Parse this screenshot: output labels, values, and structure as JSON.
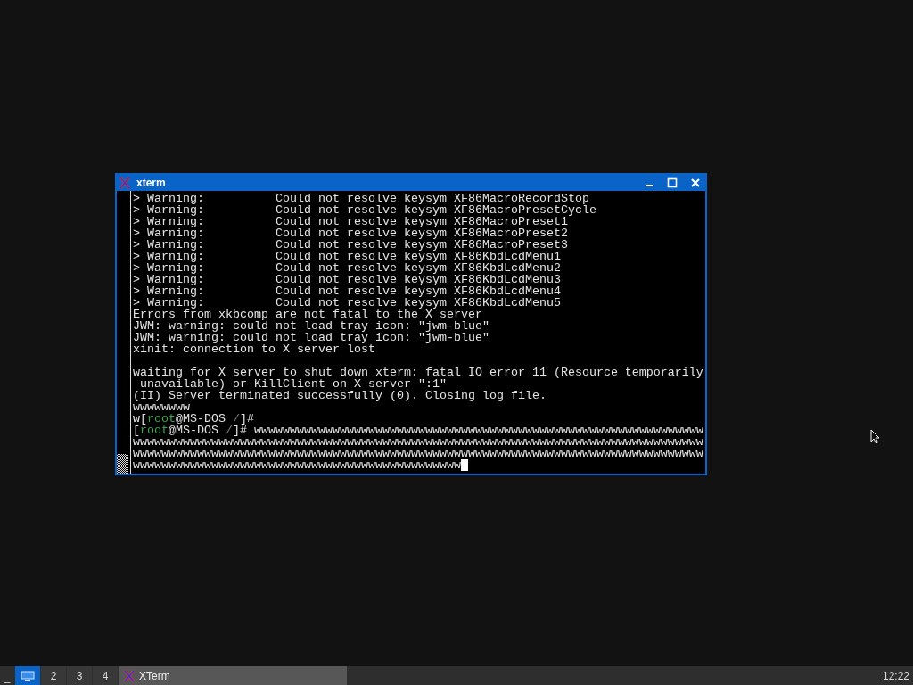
{
  "window": {
    "title": "xterm"
  },
  "terminal": {
    "cursor": true,
    "lines": [
      [
        {
          "kind": "plain",
          "text": "> Warning:          Could not resolve keysym XF86MacroRecordStop"
        }
      ],
      [
        {
          "kind": "plain",
          "text": "> Warning:          Could not resolve keysym XF86MacroPresetCycle"
        }
      ],
      [
        {
          "kind": "plain",
          "text": "> Warning:          Could not resolve keysym XF86MacroPreset1"
        }
      ],
      [
        {
          "kind": "plain",
          "text": "> Warning:          Could not resolve keysym XF86MacroPreset2"
        }
      ],
      [
        {
          "kind": "plain",
          "text": "> Warning:          Could not resolve keysym XF86MacroPreset3"
        }
      ],
      [
        {
          "kind": "plain",
          "text": "> Warning:          Could not resolve keysym XF86KbdLcdMenu1"
        }
      ],
      [
        {
          "kind": "plain",
          "text": "> Warning:          Could not resolve keysym XF86KbdLcdMenu2"
        }
      ],
      [
        {
          "kind": "plain",
          "text": "> Warning:          Could not resolve keysym XF86KbdLcdMenu3"
        }
      ],
      [
        {
          "kind": "plain",
          "text": "> Warning:          Could not resolve keysym XF86KbdLcdMenu4"
        }
      ],
      [
        {
          "kind": "plain",
          "text": "> Warning:          Could not resolve keysym XF86KbdLcdMenu5"
        }
      ],
      [
        {
          "kind": "plain",
          "text": "Errors from xkbcomp are not fatal to the X server"
        }
      ],
      [
        {
          "kind": "plain",
          "text": "JWM: warning: could not load tray icon: \"jwm-blue\""
        }
      ],
      [
        {
          "kind": "plain",
          "text": "JWM: warning: could not load tray icon: \"jwm-blue\""
        }
      ],
      [
        {
          "kind": "plain",
          "text": "xinit: connection to X server lost"
        }
      ],
      [
        {
          "kind": "blank"
        }
      ],
      [
        {
          "kind": "plain",
          "text": "waiting for X server to shut down xterm: fatal IO error 11 (Resource temporarily"
        }
      ],
      [
        {
          "kind": "plain",
          "text": " unavailable) or KillClient on X server \":1\""
        }
      ],
      [
        {
          "kind": "plain",
          "text": "(II) Server terminated successfully (0). Closing log file."
        }
      ],
      [
        {
          "kind": "plain",
          "text": "wwwwwwww"
        }
      ],
      [
        {
          "kind": "plain",
          "text": "w["
        },
        {
          "kind": "user",
          "text": "root"
        },
        {
          "kind": "plain",
          "text": "@MS-DOS "
        },
        {
          "kind": "path",
          "text": "/"
        },
        {
          "kind": "plain",
          "text": "]#"
        }
      ],
      [
        {
          "kind": "plain",
          "text": "["
        },
        {
          "kind": "user",
          "text": "root"
        },
        {
          "kind": "plain",
          "text": "@MS-DOS "
        },
        {
          "kind": "path",
          "text": "/"
        },
        {
          "kind": "plain",
          "text": "]# wwwwwwwwwwwwwwwwwwwwwwwwwwwwwwwwwwwwwwwwwwwwwwwwwwwwwwwwwwwwwww"
        }
      ],
      [
        {
          "kind": "plain",
          "text": "wwwwwwwwwwwwwwwwwwwwwwwwwwwwwwwwwwwwwwwwwwwwwwwwwwwwwwwwwwwwwwwwwwwwwwwwwwwwwwww"
        }
      ],
      [
        {
          "kind": "plain",
          "text": "wwwwwwwwwwwwwwwwwwwwwwwwwwwwwwwwwwwwwwwwwwwwwwwwwwwwwwwwwwwwwwwwwwwwwwwwwwwwwwww"
        }
      ],
      [
        {
          "kind": "plain",
          "text": "wwwwwwwwwwwwwwwwwwwwwwwwwwwwwwwwwwwwwwwwwwwwww"
        }
      ]
    ]
  },
  "taskbar": {
    "show_desktop": "_",
    "workspaces": [
      {
        "kind": "icon",
        "selected": true
      },
      {
        "kind": "label",
        "label": "2",
        "selected": false
      },
      {
        "kind": "label",
        "label": "3",
        "selected": false
      },
      {
        "kind": "label",
        "label": "4",
        "selected": false
      }
    ],
    "tasks": [
      {
        "label": "XTerm",
        "selected": true
      }
    ],
    "clock": "12:22"
  }
}
